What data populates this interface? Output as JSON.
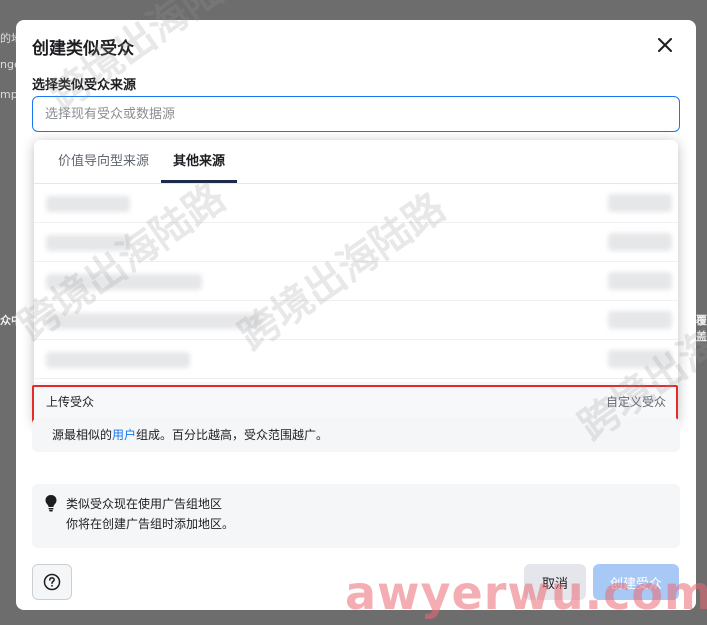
{
  "background": {
    "left_fragments": [
      "的地",
      "nge",
      "mpa",
      "众中"
    ],
    "right_fragments": [
      "覆盖"
    ]
  },
  "modal": {
    "title": "创建类似受众",
    "close_icon": "close-icon"
  },
  "source": {
    "label": "选择类似受众来源",
    "placeholder": "选择现有受众或数据源"
  },
  "dropdown": {
    "tabs": [
      {
        "label": "价值导向型来源",
        "active": false
      },
      {
        "label": "其他来源",
        "active": true
      }
    ],
    "blurred_rows": 5,
    "upload_item": {
      "label": "上传受众",
      "tag": "自定义受众"
    }
  },
  "description": {
    "prefix": "源最相似的",
    "link": "用户",
    "suffix": "组成。百分比越高，受众范围越广。"
  },
  "info": {
    "icon": "lightbulb-icon",
    "line1": "类似受众现在使用广告组地区",
    "line2": "你将在创建广告组时添加地区。"
  },
  "footer": {
    "help_icon": "question-icon",
    "cancel_label": "取消",
    "create_label": "创建受众"
  },
  "watermarks": {
    "text": "跨境出海陆路",
    "brand": "awyerwu.com"
  },
  "colors": {
    "primary": "#1877f2",
    "highlight": "#e42b2b",
    "disabled_button": "#a8c8f5"
  }
}
